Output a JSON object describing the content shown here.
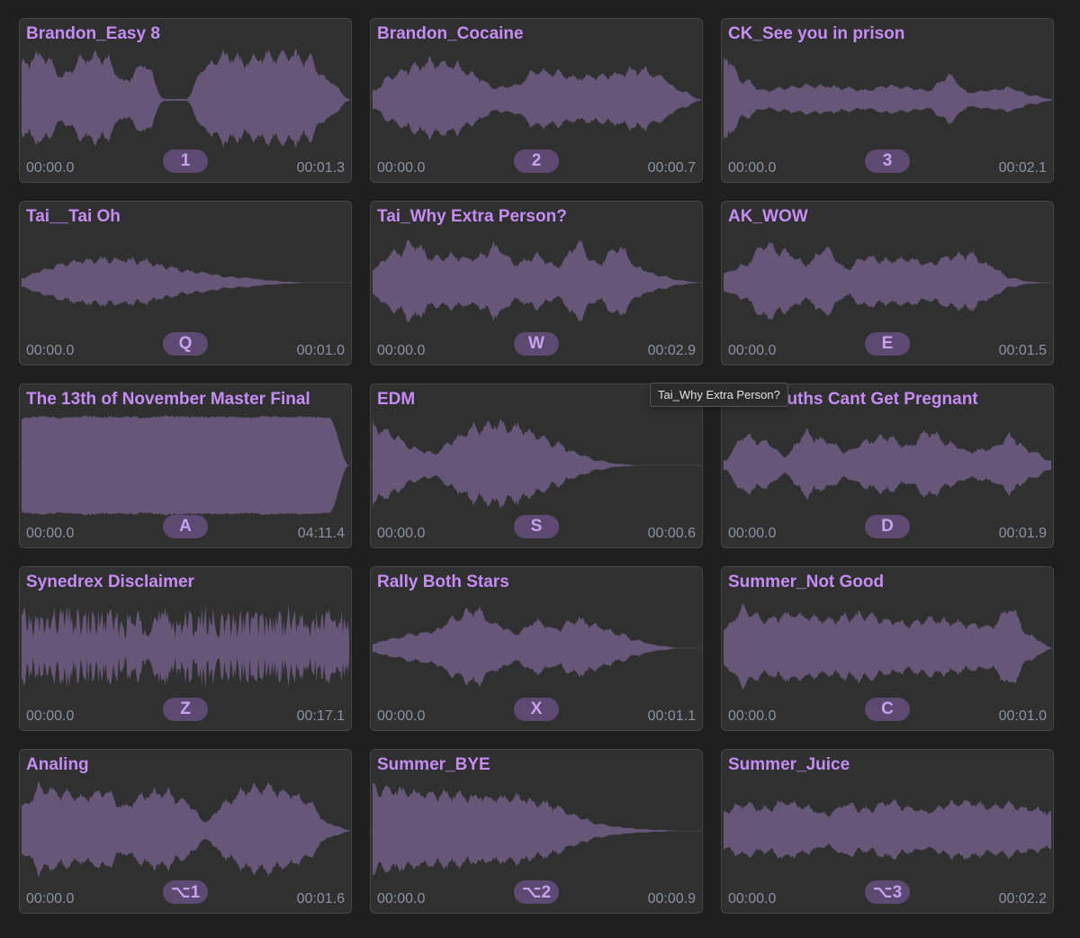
{
  "colors": {
    "background": "#1f1f1f",
    "pad_background": "#303030",
    "pad_border": "#474747",
    "title": "#c58cf5",
    "waveform": "#665677",
    "badge_background": "#5c4a72",
    "badge_text": "#c9a2ef",
    "time_text": "#8f8fa3"
  },
  "tooltip": {
    "text": "Tai_Why Extra Person?"
  },
  "pads": [
    {
      "title": "Brandon_Easy 8",
      "key": "1",
      "start": "00:00.0",
      "end": "00:01.3",
      "wave": {
        "style": "speech",
        "amps": [
          0.75,
          0.95,
          0.5,
          0.85,
          0.9,
          0.4,
          0.75,
          0.02,
          0.02,
          0.7,
          0.95,
          0.8,
          0.9,
          0.95,
          0.85,
          0.4,
          0.03
        ]
      }
    },
    {
      "title": "Brandon_Cocaine",
      "key": "2",
      "start": "00:00.0",
      "end": "00:00.7",
      "wave": {
        "style": "speech",
        "amps": [
          0.2,
          0.5,
          0.7,
          0.8,
          0.7,
          0.5,
          0.25,
          0.3,
          0.6,
          0.55,
          0.45,
          0.5,
          0.55,
          0.65,
          0.5,
          0.2,
          0.02
        ]
      }
    },
    {
      "title": "CK_See you in prison",
      "key": "3",
      "start": "00:00.0",
      "end": "00:02.1",
      "wave": {
        "style": "speech",
        "amps": [
          0.9,
          0.4,
          0.2,
          0.25,
          0.3,
          0.28,
          0.25,
          0.2,
          0.3,
          0.25,
          0.2,
          0.5,
          0.15,
          0.2,
          0.25,
          0.1,
          0.02
        ]
      }
    },
    {
      "title": "Tai__Tai Oh",
      "key": "Q",
      "start": "00:00.0",
      "end": "00:01.0",
      "wave": {
        "style": "speech",
        "amps": [
          0.1,
          0.25,
          0.4,
          0.45,
          0.5,
          0.48,
          0.45,
          0.35,
          0.25,
          0.2,
          0.12,
          0.1,
          0.05,
          0.02,
          0.0,
          0.0,
          0.0
        ]
      }
    },
    {
      "title": "Tai_Why Extra Person?",
      "key": "W",
      "start": "00:00.0",
      "end": "00:02.9",
      "wave": {
        "style": "speech",
        "amps": [
          0.3,
          0.6,
          0.8,
          0.5,
          0.55,
          0.5,
          0.75,
          0.4,
          0.55,
          0.35,
          0.8,
          0.4,
          0.75,
          0.3,
          0.15,
          0.05,
          0.0
        ]
      }
    },
    {
      "title": "AK_WOW",
      "key": "E",
      "start": "00:00.0",
      "end": "00:01.5",
      "wave": {
        "style": "speech",
        "amps": [
          0.2,
          0.35,
          0.8,
          0.65,
          0.4,
          0.7,
          0.3,
          0.55,
          0.45,
          0.5,
          0.4,
          0.55,
          0.6,
          0.35,
          0.1,
          0.02,
          0.0
        ]
      }
    },
    {
      "title": "The 13th of November Master Final",
      "key": "A",
      "start": "00:00.0",
      "end": "04:11.4",
      "wave": {
        "style": "dense",
        "amps": [
          0.92,
          0.95,
          0.93,
          0.96,
          0.94,
          0.95,
          0.93,
          0.96,
          0.95,
          0.94,
          0.95,
          0.93,
          0.96,
          0.94,
          0.95,
          0.93,
          0.0
        ]
      }
    },
    {
      "title": "EDM",
      "key": "S",
      "start": "00:00.0",
      "end": "00:00.6",
      "wave": {
        "style": "speech",
        "amps": [
          0.85,
          0.65,
          0.35,
          0.25,
          0.55,
          0.8,
          0.85,
          0.8,
          0.65,
          0.45,
          0.25,
          0.1,
          0.03,
          0.0,
          0.0,
          0.0,
          0.0
        ]
      }
    },
    {
      "title": "AK_Mouths Cant Get Pregnant",
      "key": "D",
      "start": "00:00.0",
      "end": "00:01.9",
      "wave": {
        "style": "speech",
        "amps": [
          0.1,
          0.6,
          0.5,
          0.2,
          0.65,
          0.5,
          0.3,
          0.5,
          0.6,
          0.4,
          0.7,
          0.45,
          0.3,
          0.35,
          0.6,
          0.3,
          0.1
        ]
      }
    },
    {
      "title": "Synedrex Disclaimer",
      "key": "Z",
      "start": "00:00.0",
      "end": "00:17.1",
      "wave": {
        "style": "noisy",
        "amps": [
          0.8,
          0.7,
          0.85,
          0.75,
          0.8,
          0.7,
          0.85,
          0.8,
          0.75,
          0.85,
          0.7,
          0.8,
          0.75,
          0.85,
          0.7,
          0.8,
          0.75
        ]
      }
    },
    {
      "title": "Rally Both Stars",
      "key": "X",
      "start": "00:00.0",
      "end": "00:01.1",
      "wave": {
        "style": "speech",
        "amps": [
          0.1,
          0.2,
          0.3,
          0.35,
          0.6,
          0.8,
          0.5,
          0.3,
          0.55,
          0.4,
          0.6,
          0.45,
          0.3,
          0.15,
          0.05,
          0.0,
          0.0
        ]
      }
    },
    {
      "title": "Summer_Not Good",
      "key": "C",
      "start": "00:00.0",
      "end": "00:01.0",
      "wave": {
        "style": "speech",
        "amps": [
          0.4,
          0.8,
          0.6,
          0.7,
          0.65,
          0.6,
          0.65,
          0.7,
          0.6,
          0.5,
          0.6,
          0.55,
          0.5,
          0.45,
          0.8,
          0.25,
          0.02
        ]
      }
    },
    {
      "title": "Analing",
      "key": "⌥1",
      "start": "00:00.0",
      "end": "00:01.6",
      "wave": {
        "style": "speech",
        "amps": [
          0.5,
          0.9,
          0.8,
          0.7,
          0.85,
          0.5,
          0.75,
          0.8,
          0.6,
          0.2,
          0.6,
          0.85,
          0.9,
          0.8,
          0.6,
          0.15,
          0.02
        ]
      }
    },
    {
      "title": "Summer_BYE",
      "key": "⌥2",
      "start": "00:00.0",
      "end": "00:00.9",
      "wave": {
        "style": "speech",
        "amps": [
          0.9,
          0.85,
          0.8,
          0.78,
          0.75,
          0.72,
          0.7,
          0.68,
          0.6,
          0.5,
          0.3,
          0.15,
          0.08,
          0.04,
          0.02,
          0.0,
          0.0
        ]
      }
    },
    {
      "title": "Summer_Juice",
      "key": "⌥3",
      "start": "00:00.0",
      "end": "00:02.2",
      "wave": {
        "style": "speech",
        "amps": [
          0.4,
          0.55,
          0.45,
          0.6,
          0.5,
          0.35,
          0.55,
          0.45,
          0.6,
          0.5,
          0.4,
          0.55,
          0.6,
          0.5,
          0.55,
          0.45,
          0.4
        ]
      }
    }
  ]
}
